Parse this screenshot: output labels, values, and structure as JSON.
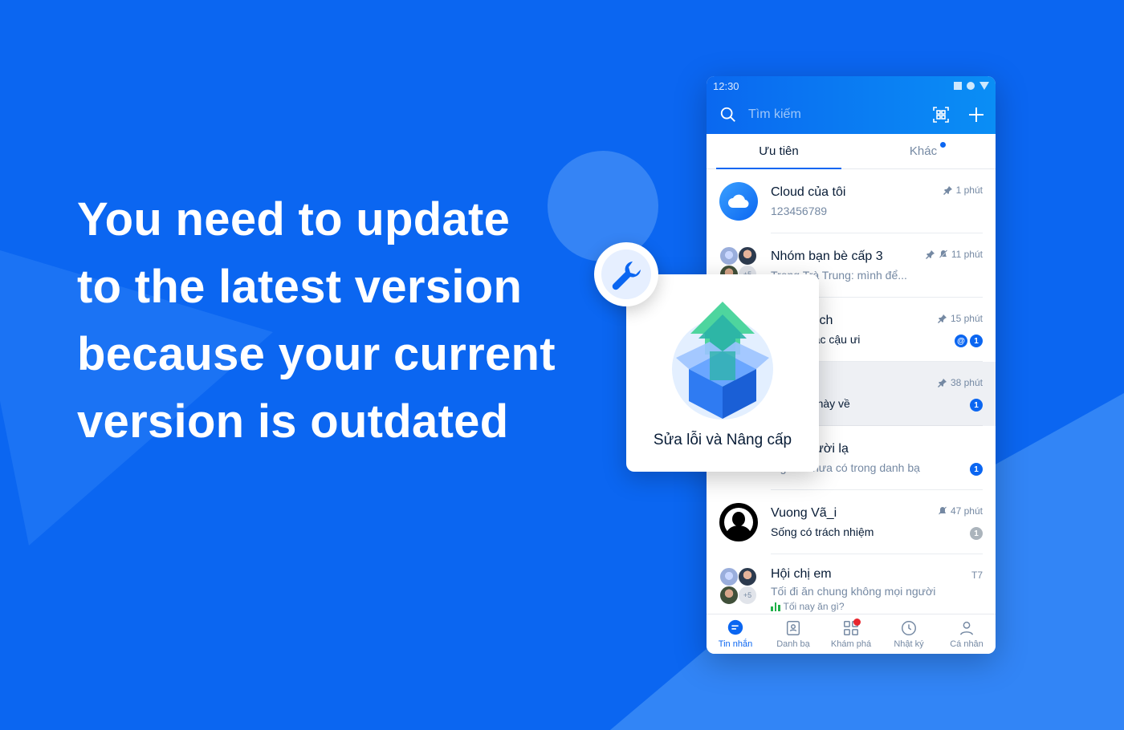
{
  "headline": {
    "lines": [
      "You need to update",
      "to the latest version",
      "because your current",
      "version is outdated"
    ]
  },
  "colors": {
    "background": "#0b66f1",
    "accent": "#0b66f1",
    "badge_red": "#e8262e",
    "poll_green": "#21b14a"
  },
  "phone": {
    "status_time": "12:30",
    "search": {
      "placeholder": "Tìm kiếm"
    },
    "tabs": [
      {
        "label": "Ưu tiên",
        "active": true
      },
      {
        "label": "Khác",
        "active": false,
        "has_dot": true
      }
    ],
    "conversations": [
      {
        "name": "Cloud của tôi",
        "preview": "123456789",
        "time": "1 phút",
        "pinned": true,
        "avatar": "cloud-icon"
      },
      {
        "name": "Nhóm bạn bè cấp 3",
        "preview": "Trọng Trà Trung: mình để...",
        "time": "11 phút",
        "pinned": true,
        "muted": true,
        "avatar": "group",
        "group_extra": "+5"
      },
      {
        "name": "...n vô địch",
        "preview": "...t quá các cậu ưi",
        "time": "15 phút",
        "pinned": true,
        "mention": "@",
        "unread": "1"
      },
      {
        "name": "",
        "preview": "...i tháng này về",
        "time": "38 phút",
        "pinned": true,
        "unread": "1"
      },
      {
        "name": "... từ người lạ",
        "preview": "...gười chưa có trong danh bạ",
        "unread": "1"
      },
      {
        "name": "Vuong Vã_i",
        "preview": "Sống có trách nhiệm",
        "time": "47 phút",
        "muted": true,
        "unread": "1",
        "unread_grey": true,
        "avatar": "person"
      },
      {
        "name": "Hội chị em",
        "preview": "Tối đi ăn chung không mọi người",
        "time": "T7",
        "poll": "Tối nay ăn gì?",
        "avatar": "group",
        "group_extra": "+5"
      }
    ],
    "bottom_nav": [
      {
        "label": "Tin nhắn",
        "icon": "chat-icon",
        "active": true
      },
      {
        "label": "Danh bạ",
        "icon": "contacts-icon"
      },
      {
        "label": "Khám phá",
        "icon": "grid-icon",
        "has_dot": true
      },
      {
        "label": "Nhật ký",
        "icon": "clock-icon"
      },
      {
        "label": "Cá nhân",
        "icon": "person-icon"
      }
    ]
  },
  "update_card": {
    "title": "Sửa lỗi và Nâng cấp",
    "icon": "upgrade-box-icon",
    "badge_icon": "wrench-icon"
  }
}
